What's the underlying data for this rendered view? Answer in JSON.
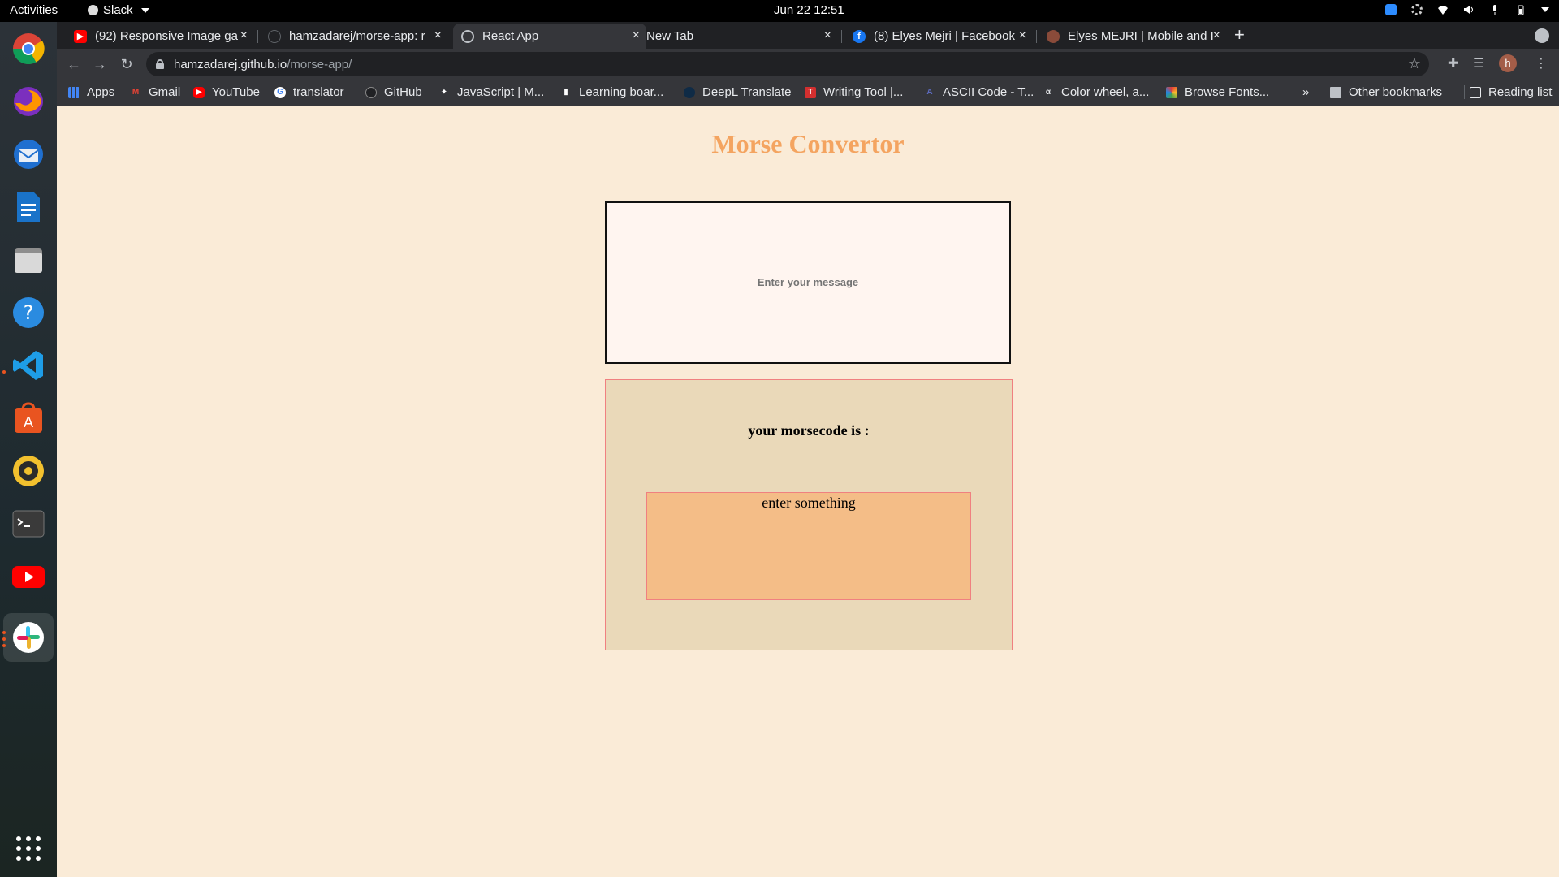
{
  "system_bar": {
    "activities": "Activities",
    "app_name": "Slack",
    "clock": "Jun 22  12:51",
    "tray_icons": [
      "zoom-icon",
      "slack-tray-icon",
      "wifi-icon",
      "volume-icon",
      "microphone-icon",
      "battery-icon",
      "system-menu-caret-icon"
    ]
  },
  "dock": {
    "items": [
      "chrome-icon",
      "firefox-icon",
      "thunderbird-icon",
      "writer-icon",
      "files-icon",
      "help-icon",
      "vscode-icon",
      "software-center-icon",
      "rhythmbox-icon",
      "terminal-icon",
      "youtube-icon",
      "slack-icon",
      "show-apps-icon"
    ]
  },
  "browser": {
    "tabs": [
      {
        "title": "(92) Responsive Image ga",
        "icon": "youtube-favicon",
        "color": "#ff0000"
      },
      {
        "title": "hamzadarej/morse-app: r",
        "icon": "github-favicon",
        "color": "#202124"
      },
      {
        "title": "React App",
        "icon": "globe-favicon",
        "color": "#bdc1c6"
      },
      {
        "title": "New Tab",
        "icon": "none",
        "color": ""
      },
      {
        "title": "(8) Elyes Mejri | Facebook",
        "icon": "facebook-favicon",
        "color": "#1877f2"
      },
      {
        "title": "Elyes MEJRI | Mobile and I",
        "icon": "avatar-favicon",
        "color": "#8a4b3a"
      }
    ],
    "active_tab_index": 2,
    "new_tab": "+",
    "url_host": "hamzadarej.github.io",
    "url_path": "/morse-app/",
    "profile_initial": "h",
    "bookmarks": [
      {
        "label": "Apps",
        "icon": "apps-grid-icon",
        "color": "#4285f4"
      },
      {
        "label": "Gmail",
        "icon": "gmail-icon",
        "color": "#ea4335"
      },
      {
        "label": "YouTube",
        "icon": "youtube-icon",
        "color": "#ff0000"
      },
      {
        "label": "translator",
        "icon": "google-icon",
        "color": "#ffffff"
      },
      {
        "label": "GitHub",
        "icon": "github-icon",
        "color": "#202124"
      },
      {
        "label": "JavaScript | M...",
        "icon": "mdn-icon",
        "color": "#ffffff"
      },
      {
        "label": "Learning boar...",
        "icon": "bookmark-icon",
        "color": "#ffffff"
      },
      {
        "label": "DeepL Translate",
        "icon": "deepl-icon",
        "color": "#0f2b46"
      },
      {
        "label": "Writing Tool |...",
        "icon": "writing-tool-icon",
        "color": "#d32f2f"
      },
      {
        "label": "ASCII Code - T...",
        "icon": "ascii-icon",
        "color": "#3949ab"
      },
      {
        "label": "Color wheel, a...",
        "icon": "color-wheel-icon",
        "color": "#ffffff"
      },
      {
        "label": "Browse Fonts...",
        "icon": "fonts-icon",
        "color": "#e53935"
      }
    ],
    "overflow": "»",
    "other_bookmarks": "Other bookmarks",
    "reading_list": "Reading list"
  },
  "page": {
    "title": "Morse Convertor",
    "message_placeholder": "Enter your message",
    "result_label": "your morsecode is :",
    "result_text": "enter something",
    "colors": {
      "background": "#faebd7",
      "title": "#f4a460",
      "input_bg": "#fff5f0",
      "panel_bg": "#ead9b9",
      "result_bg": "#f4bd87",
      "panel_border": "#f08080"
    }
  }
}
